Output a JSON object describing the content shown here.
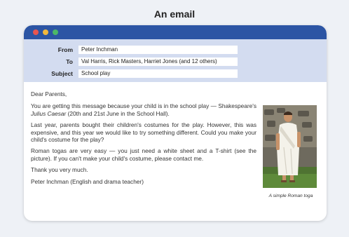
{
  "page_title": "An email",
  "header": {
    "from_label": "From",
    "from_value": "Peter Inchman",
    "to_label": "To",
    "to_value": "Val Harris, Rick Masters, Harriet Jones (and 12 others)",
    "subject_label": "Subject",
    "subject_value": "School play"
  },
  "body": {
    "greeting": "Dear Parents,",
    "p1_a": "You are getting this message because your child is in the school play — Shakespeare's ",
    "p1_play": "Julius Caesar",
    "p1_b": " (20th and 21st June in the School Hall).",
    "p2": "Last year, parents bought their children's costumes for the play. However, this was expensive, and this year we would like to try something different. Could you make your child's costume for the play?",
    "p3": "Roman togas are very easy — you just need a white sheet and a T-shirt (see the picture). If you can't make your child's costume, please contact me.",
    "thanks": "Thank you very much.",
    "signature": "Peter Inchman (English and drama teacher)"
  },
  "image": {
    "caption": "A simple Roman toga"
  }
}
